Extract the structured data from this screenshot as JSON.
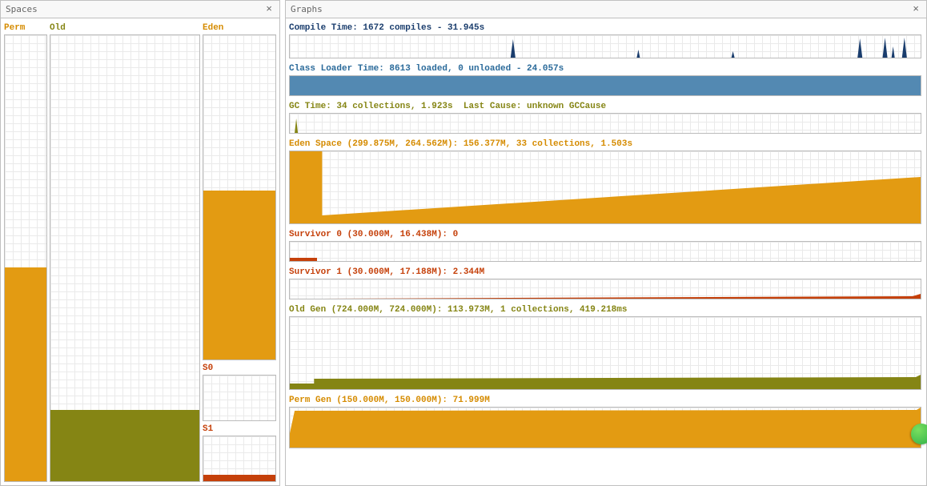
{
  "spaces_panel": {
    "title": "Spaces",
    "close": "×"
  },
  "graphs_panel": {
    "title": "Graphs",
    "close": "×"
  },
  "spaces": {
    "perm": {
      "label": "Perm",
      "fill_pct": 48,
      "color_class": "f-orange",
      "title_class": "c-orange"
    },
    "old": {
      "label": "Old",
      "fill_pct": 16,
      "color_class": "f-olive",
      "title_class": "c-olive"
    },
    "eden": {
      "label": "Eden",
      "fill_pct": 52,
      "color_class": "f-orange",
      "title_class": "c-orange"
    },
    "s0": {
      "label": "S0",
      "fill_pct": 0,
      "color_class": "f-brick",
      "title_class": "c-brick"
    },
    "s1": {
      "label": "S1",
      "fill_pct": 14,
      "color_class": "f-brick",
      "title_class": "c-brick"
    }
  },
  "graphs": {
    "compile": {
      "label": "Compile Time: 1672 compiles - 31.945s",
      "height": 28,
      "title_class": "c-navy"
    },
    "classload": {
      "label": "Class Loader Time: 8613 loaded, 0 unloaded - 24.057s",
      "height": 24,
      "title_class": "c-steel"
    },
    "gc": {
      "label": "GC Time: 34 collections, 1.923s",
      "extra": "Last Cause: unknown GCCause",
      "height": 24,
      "title_class": "c-olive"
    },
    "eden": {
      "label": "Eden Space (299.875M, 264.562M): 156.377M, 33 collections, 1.503s",
      "height": 90,
      "title_class": "c-orange"
    },
    "surv0": {
      "label": "Survivor 0 (30.000M, 16.438M): 0",
      "height": 24,
      "title_class": "c-brick"
    },
    "surv1": {
      "label": "Survivor 1 (30.000M, 17.188M): 2.344M",
      "height": 24,
      "title_class": "c-brick"
    },
    "old": {
      "label": "Old Gen (724.000M, 724.000M): 113.973M, 1 collections, 419.218ms",
      "height": 90,
      "title_class": "c-olive"
    },
    "permg": {
      "label": "Perm Gen (150.000M, 150.000M): 71.999M",
      "height": 50,
      "title_class": "c-orange"
    }
  },
  "chart_data": [
    {
      "type": "bar",
      "title": "Perm",
      "ylim": [
        0,
        100
      ],
      "values": [
        48
      ]
    },
    {
      "type": "bar",
      "title": "Old",
      "ylim": [
        0,
        100
      ],
      "values": [
        16
      ]
    },
    {
      "type": "bar",
      "title": "Eden",
      "ylim": [
        0,
        100
      ],
      "values": [
        52
      ]
    },
    {
      "type": "bar",
      "title": "S0",
      "ylim": [
        0,
        100
      ],
      "values": [
        0
      ]
    },
    {
      "type": "bar",
      "title": "S1",
      "ylim": [
        0,
        100
      ],
      "values": [
        14
      ]
    },
    {
      "type": "area",
      "title": "Compile Time",
      "ylim": [
        0,
        30
      ],
      "x": [
        0,
        100
      ],
      "spikes": [
        35,
        55,
        70,
        90,
        94,
        97
      ]
    },
    {
      "type": "area",
      "title": "Class Loader Time",
      "ylim": [
        0,
        1
      ],
      "values": "full"
    },
    {
      "type": "area",
      "title": "GC Time",
      "ylim": [
        0,
        30
      ],
      "spikes": [
        1
      ]
    },
    {
      "type": "area",
      "title": "Eden Space",
      "ylim": [
        0,
        300
      ],
      "shape": "step-high-then-ramp",
      "step_x": 5,
      "step_y": 260,
      "ramp_from": 10,
      "ramp_to_y": 195
    },
    {
      "type": "area",
      "title": "Survivor 0",
      "ylim": [
        0,
        30
      ],
      "values": [
        {
          "x": 0,
          "w": 4,
          "h": 5
        }
      ]
    },
    {
      "type": "area",
      "title": "Survivor 1",
      "ylim": [
        0,
        30
      ],
      "values": [
        {
          "x": 5,
          "w": 95,
          "h": 2.3
        }
      ]
    },
    {
      "type": "area",
      "title": "Old Gen",
      "ylim": [
        0,
        724
      ],
      "shape": "step-fill",
      "left_seg_w": 4,
      "left_h": 60,
      "right_h": 114
    },
    {
      "type": "area",
      "title": "Perm Gen",
      "ylim": [
        0,
        150
      ],
      "shape": "near-full",
      "left_gap": 0.5,
      "h": 72
    }
  ]
}
